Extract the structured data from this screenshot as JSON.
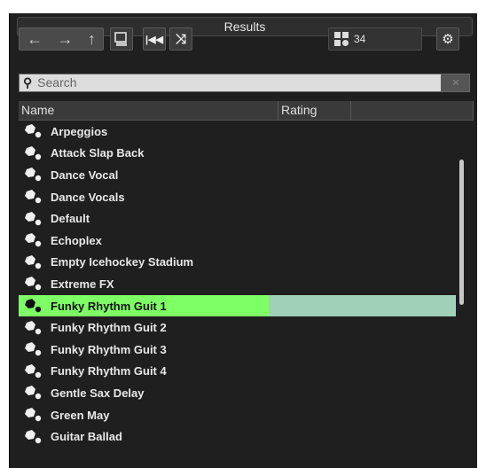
{
  "panel": {
    "title": "Results"
  },
  "toolbar": {
    "count": "34",
    "buttons": [
      "back-icon",
      "forward-icon",
      "up-icon",
      "view-icon",
      "rewind-icon",
      "shuffle-icon",
      "settings-icon"
    ]
  },
  "search": {
    "placeholder": "Search",
    "clear": "×"
  },
  "columns": [
    "Name",
    "Rating",
    ""
  ],
  "rows": [
    {
      "label": "Arpeggios"
    },
    {
      "label": "Attack Slap Back"
    },
    {
      "label": "Dance Vocal"
    },
    {
      "label": "Dance Vocals"
    },
    {
      "label": "Default"
    },
    {
      "label": "Echoplex"
    },
    {
      "label": "Empty Icehockey Stadium"
    },
    {
      "label": "Extreme FX"
    },
    {
      "label": "Funky Rhythm Guit 1",
      "selected": true
    },
    {
      "label": "Funky Rhythm Guit 2"
    },
    {
      "label": "Funky Rhythm Guit 3"
    },
    {
      "label": "Funky Rhythm Guit 4"
    },
    {
      "label": "Gentle Sax Delay"
    },
    {
      "label": "Green May"
    },
    {
      "label": "Guitar Ballad"
    }
  ],
  "colors": {
    "selected_row": "#7fff66",
    "rating_highlight": "#9fd0b8"
  }
}
